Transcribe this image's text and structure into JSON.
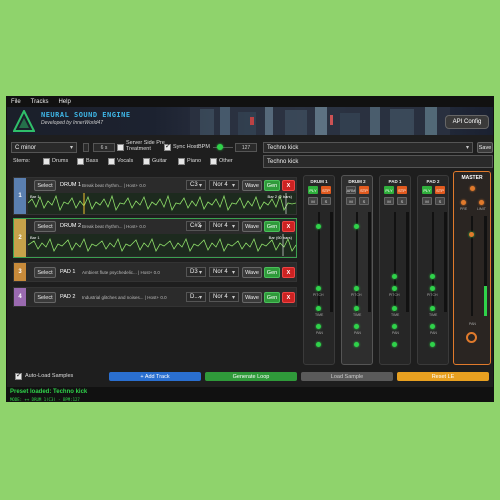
{
  "menu": [
    "File",
    "Tracks",
    "Help"
  ],
  "header": {
    "title": "NEURAL SOUND ENGINE",
    "subtitle": "Developed by InnerWorld47",
    "api_button": "API Config"
  },
  "controls": {
    "key": "C minor",
    "bars_value": "6 s",
    "server_side_label": "Server Side Pre Treatment",
    "sync_host_label": "Sync Host",
    "bpm_label": "BPM",
    "bpm_value": "127",
    "preset": "Techno kick",
    "save_label": "Save",
    "prompt_text": "Techno kick",
    "stems_label": "Stems:",
    "stems": [
      {
        "label": "Drums",
        "checked": false
      },
      {
        "label": "Bass",
        "checked": false
      },
      {
        "label": "Vocals",
        "checked": false
      },
      {
        "label": "Guitar",
        "checked": false
      },
      {
        "label": "Piano",
        "checked": false
      },
      {
        "label": "Other",
        "checked": false
      }
    ]
  },
  "tracks": [
    {
      "num": "1",
      "color": "#5a7fb0",
      "select": "Select",
      "name": "DRUM 1",
      "desc": "Break beat rhythm... | Host+ 0.0",
      "note": "C3",
      "mode": "Nor 4",
      "wave": "Wave",
      "gen": "Gen",
      "del": "X",
      "bar_label": "Bar 1",
      "info": "Bar 2 (2 bars)"
    },
    {
      "num": "2",
      "color": "#3aa050",
      "select": "Select",
      "name": "DRUM 2",
      "desc": "Break beat rhythm... | Host+ 0.0",
      "note": "C#3",
      "mode": "Nor 4",
      "wave": "Wave",
      "gen": "Gen",
      "del": "X",
      "bar_label": "Bar 1",
      "info": "Bar (60 bars)"
    },
    {
      "num": "3",
      "color": "#c78a3a",
      "select": "Select",
      "name": "PAD 1",
      "desc": "Ambient flute psychedelic... | Host+ 0.0",
      "note": "D3",
      "mode": "Nor 4",
      "wave": "Wave",
      "gen": "Gen",
      "del": "X"
    },
    {
      "num": "4",
      "color": "#9a6ab0",
      "select": "Select",
      "name": "PAD 2",
      "desc": "Industrial glitches and noises... | Host+ 0.0",
      "note": "D...",
      "mode": "Nor 4",
      "wave": "Wave",
      "gen": "Gen",
      "del": "X"
    }
  ],
  "mixer": {
    "strips": [
      {
        "name": "DRUM 1",
        "b1": "PLY",
        "b2": "STP",
        "mute": "M",
        "solo": "S"
      },
      {
        "name": "DRUM 2",
        "b1": "ARM",
        "b2": "STP",
        "mute": "M",
        "solo": "S"
      },
      {
        "name": "PAD 1",
        "b1": "PLY",
        "b2": "STP",
        "mute": "M",
        "solo": "S"
      },
      {
        "name": "PAD 2",
        "b1": "PLY",
        "b2": "STP",
        "mute": "M",
        "solo": "S"
      }
    ],
    "knob_labels": [
      "PITCH",
      "TIME",
      "PAN"
    ],
    "master": {
      "name": "MASTER",
      "k1": "PRE",
      "k2": "LIMIT",
      "k3": "PAN"
    }
  },
  "bottom": {
    "auto_load": "Auto-Load Samples",
    "add_track": "+ Add Track",
    "generate_loop": "Generate Loop",
    "load_sample": "Load Sample",
    "reset": "Reset LE"
  },
  "status": {
    "line1": "Preset loaded: Techno kick",
    "line2": "MODE: ++ DRUM 1(C3) - BPM:127"
  },
  "colors": {
    "accent_green": "#2fd24a",
    "accent_orange": "#e07a2c",
    "bg": "#8fd36c"
  }
}
